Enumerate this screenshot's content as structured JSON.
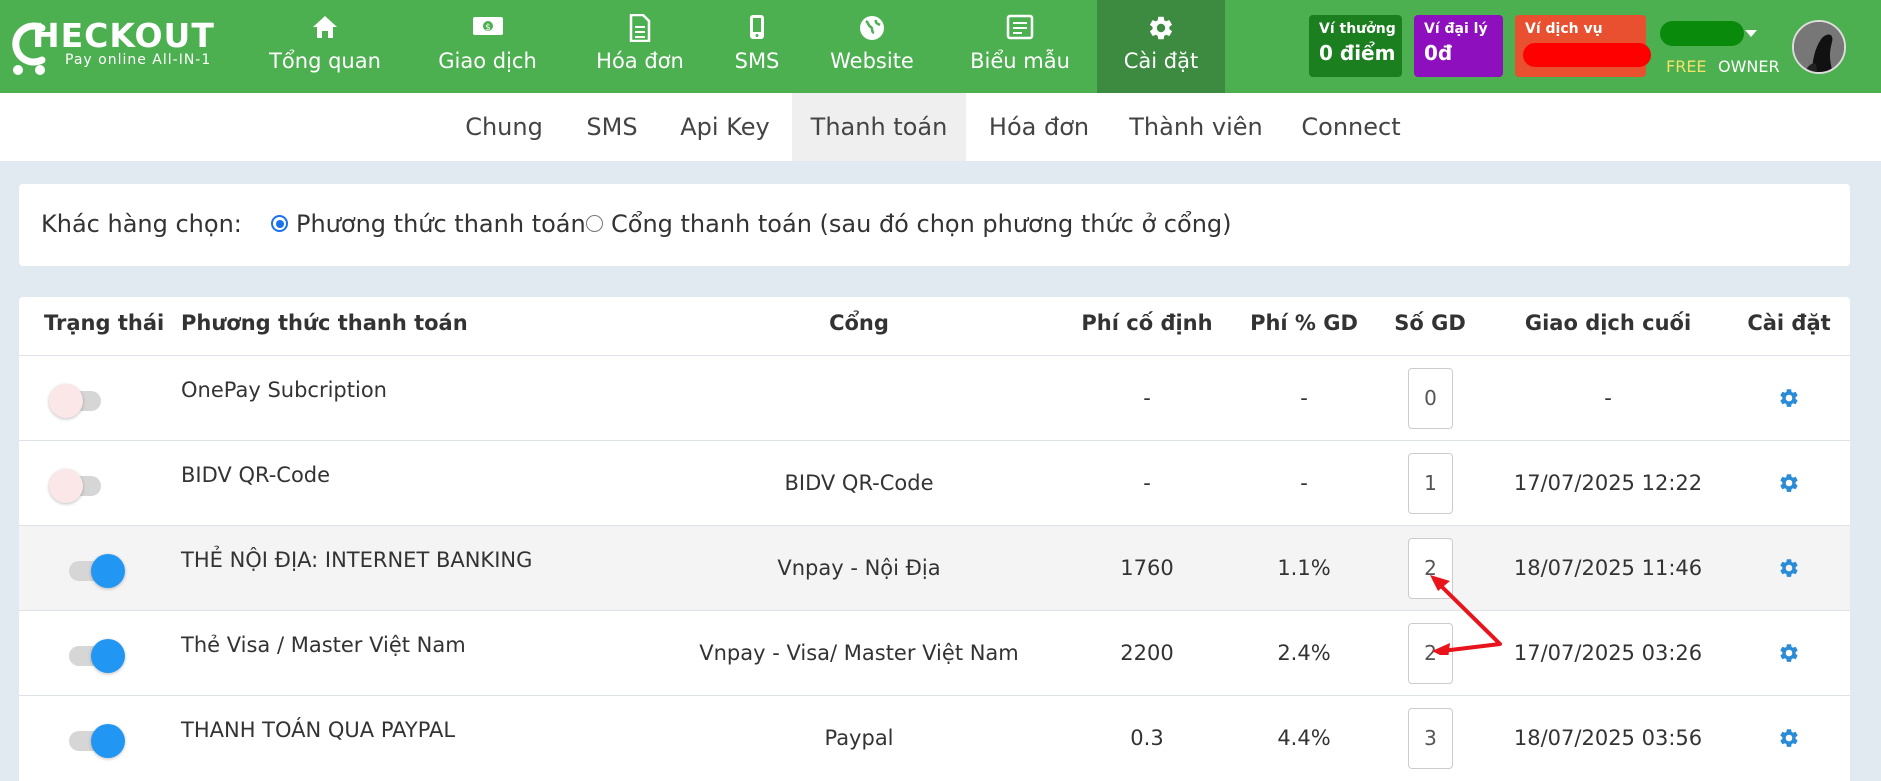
{
  "brand": {
    "name": "HECKOUT",
    "tagline": "Pay online All-IN-1"
  },
  "nav": {
    "items": [
      {
        "label": "Tổng quan",
        "icon": "home-icon"
      },
      {
        "label": "Giao dịch",
        "icon": "money-icon"
      },
      {
        "label": "Hóa đơn",
        "icon": "document-icon"
      },
      {
        "label": "SMS",
        "icon": "mobile-icon"
      },
      {
        "label": "Website",
        "icon": "globe-icon"
      },
      {
        "label": "Biểu mẫu",
        "icon": "form-icon"
      },
      {
        "label": "Cài đặt",
        "icon": "gear-icon"
      }
    ],
    "active_index": 6
  },
  "wallets": [
    {
      "title": "Ví thưởng",
      "value": "0 điểm",
      "color": "#1b7f1f"
    },
    {
      "title": "Ví đại lý",
      "value": "0đ",
      "color": "#8e0fbd"
    },
    {
      "title": "Ví dịch vụ",
      "value": "",
      "color": "#e8502f"
    }
  ],
  "account": {
    "plan": "FREE",
    "role": "OWNER"
  },
  "subnav": {
    "items": [
      "Chung",
      "SMS",
      "Api Key",
      "Thanh toán",
      "Hóa đơn",
      "Thành viên",
      "Connect"
    ],
    "active_index": 3
  },
  "choice": {
    "label": "Khác hàng chọn:",
    "option1": "Phương thức thanh toán",
    "option2": "Cổng thanh toán (sau đó chọn phương thức ở cổng)",
    "selected": 1
  },
  "table": {
    "headers": [
      "Trạng thái",
      "Phương thức thanh toán",
      "Cổng",
      "Phí cố định",
      "Phí % GD",
      "Số GD",
      "Giao dịch cuối",
      "Cài đặt"
    ],
    "rows": [
      {
        "enabled": false,
        "method": "OnePay Subcription",
        "gateway": "",
        "fixed_fee": "-",
        "pct_fee": "-",
        "count": "0",
        "last": "-"
      },
      {
        "enabled": false,
        "method": "BIDV QR-Code",
        "gateway": "BIDV QR-Code",
        "fixed_fee": "-",
        "pct_fee": "-",
        "count": "1",
        "last": "17/07/2025 12:22"
      },
      {
        "enabled": true,
        "method": "THẺ NỘI ĐỊA: INTERNET BANKING",
        "gateway": "Vnpay - Nội Địa",
        "fixed_fee": "1760",
        "pct_fee": "1.1%",
        "count": "2",
        "last": "18/07/2025 11:46"
      },
      {
        "enabled": true,
        "method": "Thẻ Visa / Master Việt Nam",
        "gateway": "Vnpay - Visa/ Master Việt Nam",
        "fixed_fee": "2200",
        "pct_fee": "2.4%",
        "count": "2",
        "last": "17/07/2025 03:26"
      },
      {
        "enabled": true,
        "method": "THANH TOÁN QUA PAYPAL",
        "gateway": "Paypal",
        "fixed_fee": "0.3",
        "pct_fee": "4.4%",
        "count": "3",
        "last": "18/07/2025 03:56"
      }
    ]
  }
}
